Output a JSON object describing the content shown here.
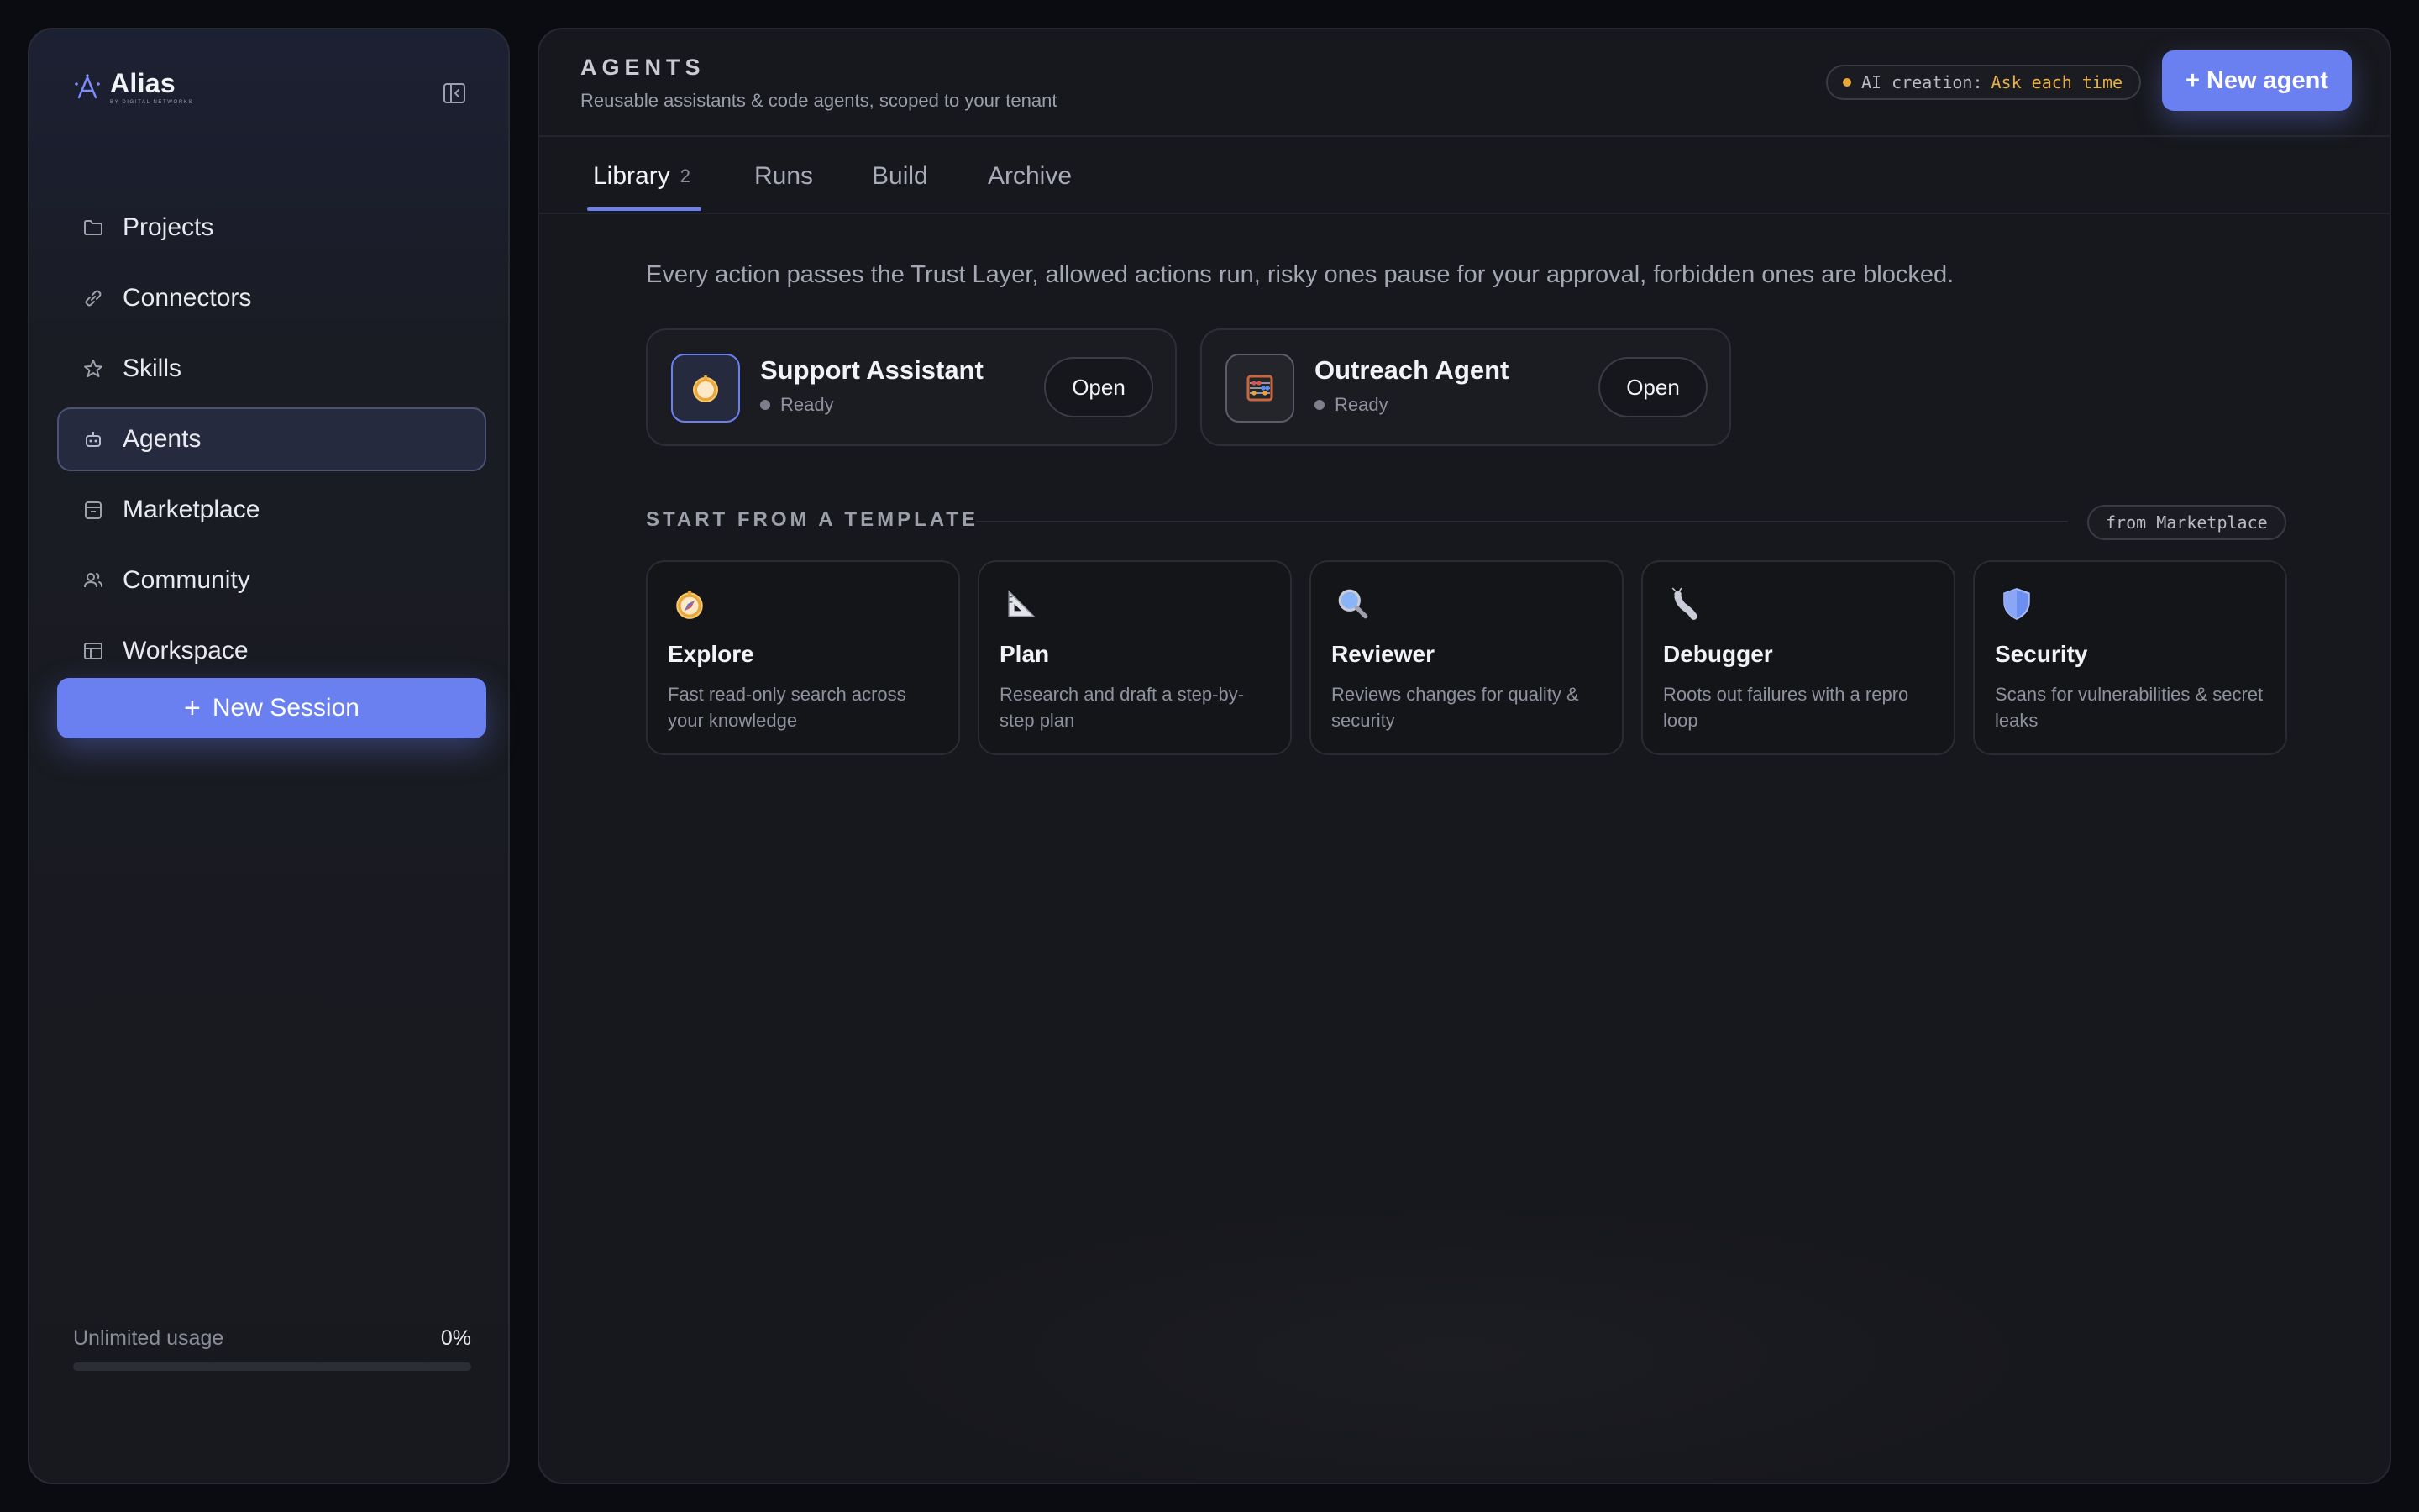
{
  "sidebar": {
    "brand": {
      "name": "Alias",
      "tagline": "BY DIGITAL NETWORKS"
    },
    "items": [
      {
        "label": "Projects",
        "icon": "folder-icon"
      },
      {
        "label": "Connectors",
        "icon": "link-icon"
      },
      {
        "label": "Skills",
        "icon": "star-icon"
      },
      {
        "label": "Agents",
        "icon": "robot-icon",
        "active": true
      },
      {
        "label": "Marketplace",
        "icon": "store-icon"
      },
      {
        "label": "Community",
        "icon": "people-icon"
      },
      {
        "label": "Workspace",
        "icon": "layout-icon"
      }
    ],
    "new_session_label": "New Session",
    "usage": {
      "label": "Unlimited usage",
      "value": "0%",
      "fraction": 0
    }
  },
  "header": {
    "title": "AGENTS",
    "subtitle": "Reusable assistants & code agents, scoped to your tenant",
    "ai_creation_label": "AI creation:",
    "ai_creation_value": "Ask each time",
    "new_agent_label": "+ New agent"
  },
  "tabs": [
    {
      "label": "Library",
      "count": "2",
      "active": true
    },
    {
      "label": "Runs"
    },
    {
      "label": "Build"
    },
    {
      "label": "Archive"
    }
  ],
  "main": {
    "trust_text": "Every action passes the Trust Layer, allowed actions run, risky ones pause for your approval, forbidden ones are blocked.",
    "agents": [
      {
        "name": "Support Assistant",
        "status": "Ready",
        "open_label": "Open",
        "icon": "compass-icon"
      },
      {
        "name": "Outreach Agent",
        "status": "Ready",
        "open_label": "Open",
        "icon": "abacus-icon"
      }
    ],
    "templates_title": "START FROM A TEMPLATE",
    "templates_source": "from Marketplace",
    "templates": [
      {
        "name": "Explore",
        "desc": "Fast read-only search across your knowledge",
        "icon": "compass-icon"
      },
      {
        "name": "Plan",
        "desc": "Research and draft a step-by-step plan",
        "icon": "triangle-ruler-icon"
      },
      {
        "name": "Reviewer",
        "desc": "Reviews changes for quality & security",
        "icon": "magnifier-icon"
      },
      {
        "name": "Debugger",
        "desc": "Roots out failures with a repro loop",
        "icon": "bug-icon"
      },
      {
        "name": "Security",
        "desc": "Scans for vulnerabilities & secret leaks",
        "icon": "shield-icon"
      }
    ]
  },
  "colors": {
    "accent": "#6a7ff0",
    "warning": "#e8a63c",
    "background": "#0b0c11"
  }
}
